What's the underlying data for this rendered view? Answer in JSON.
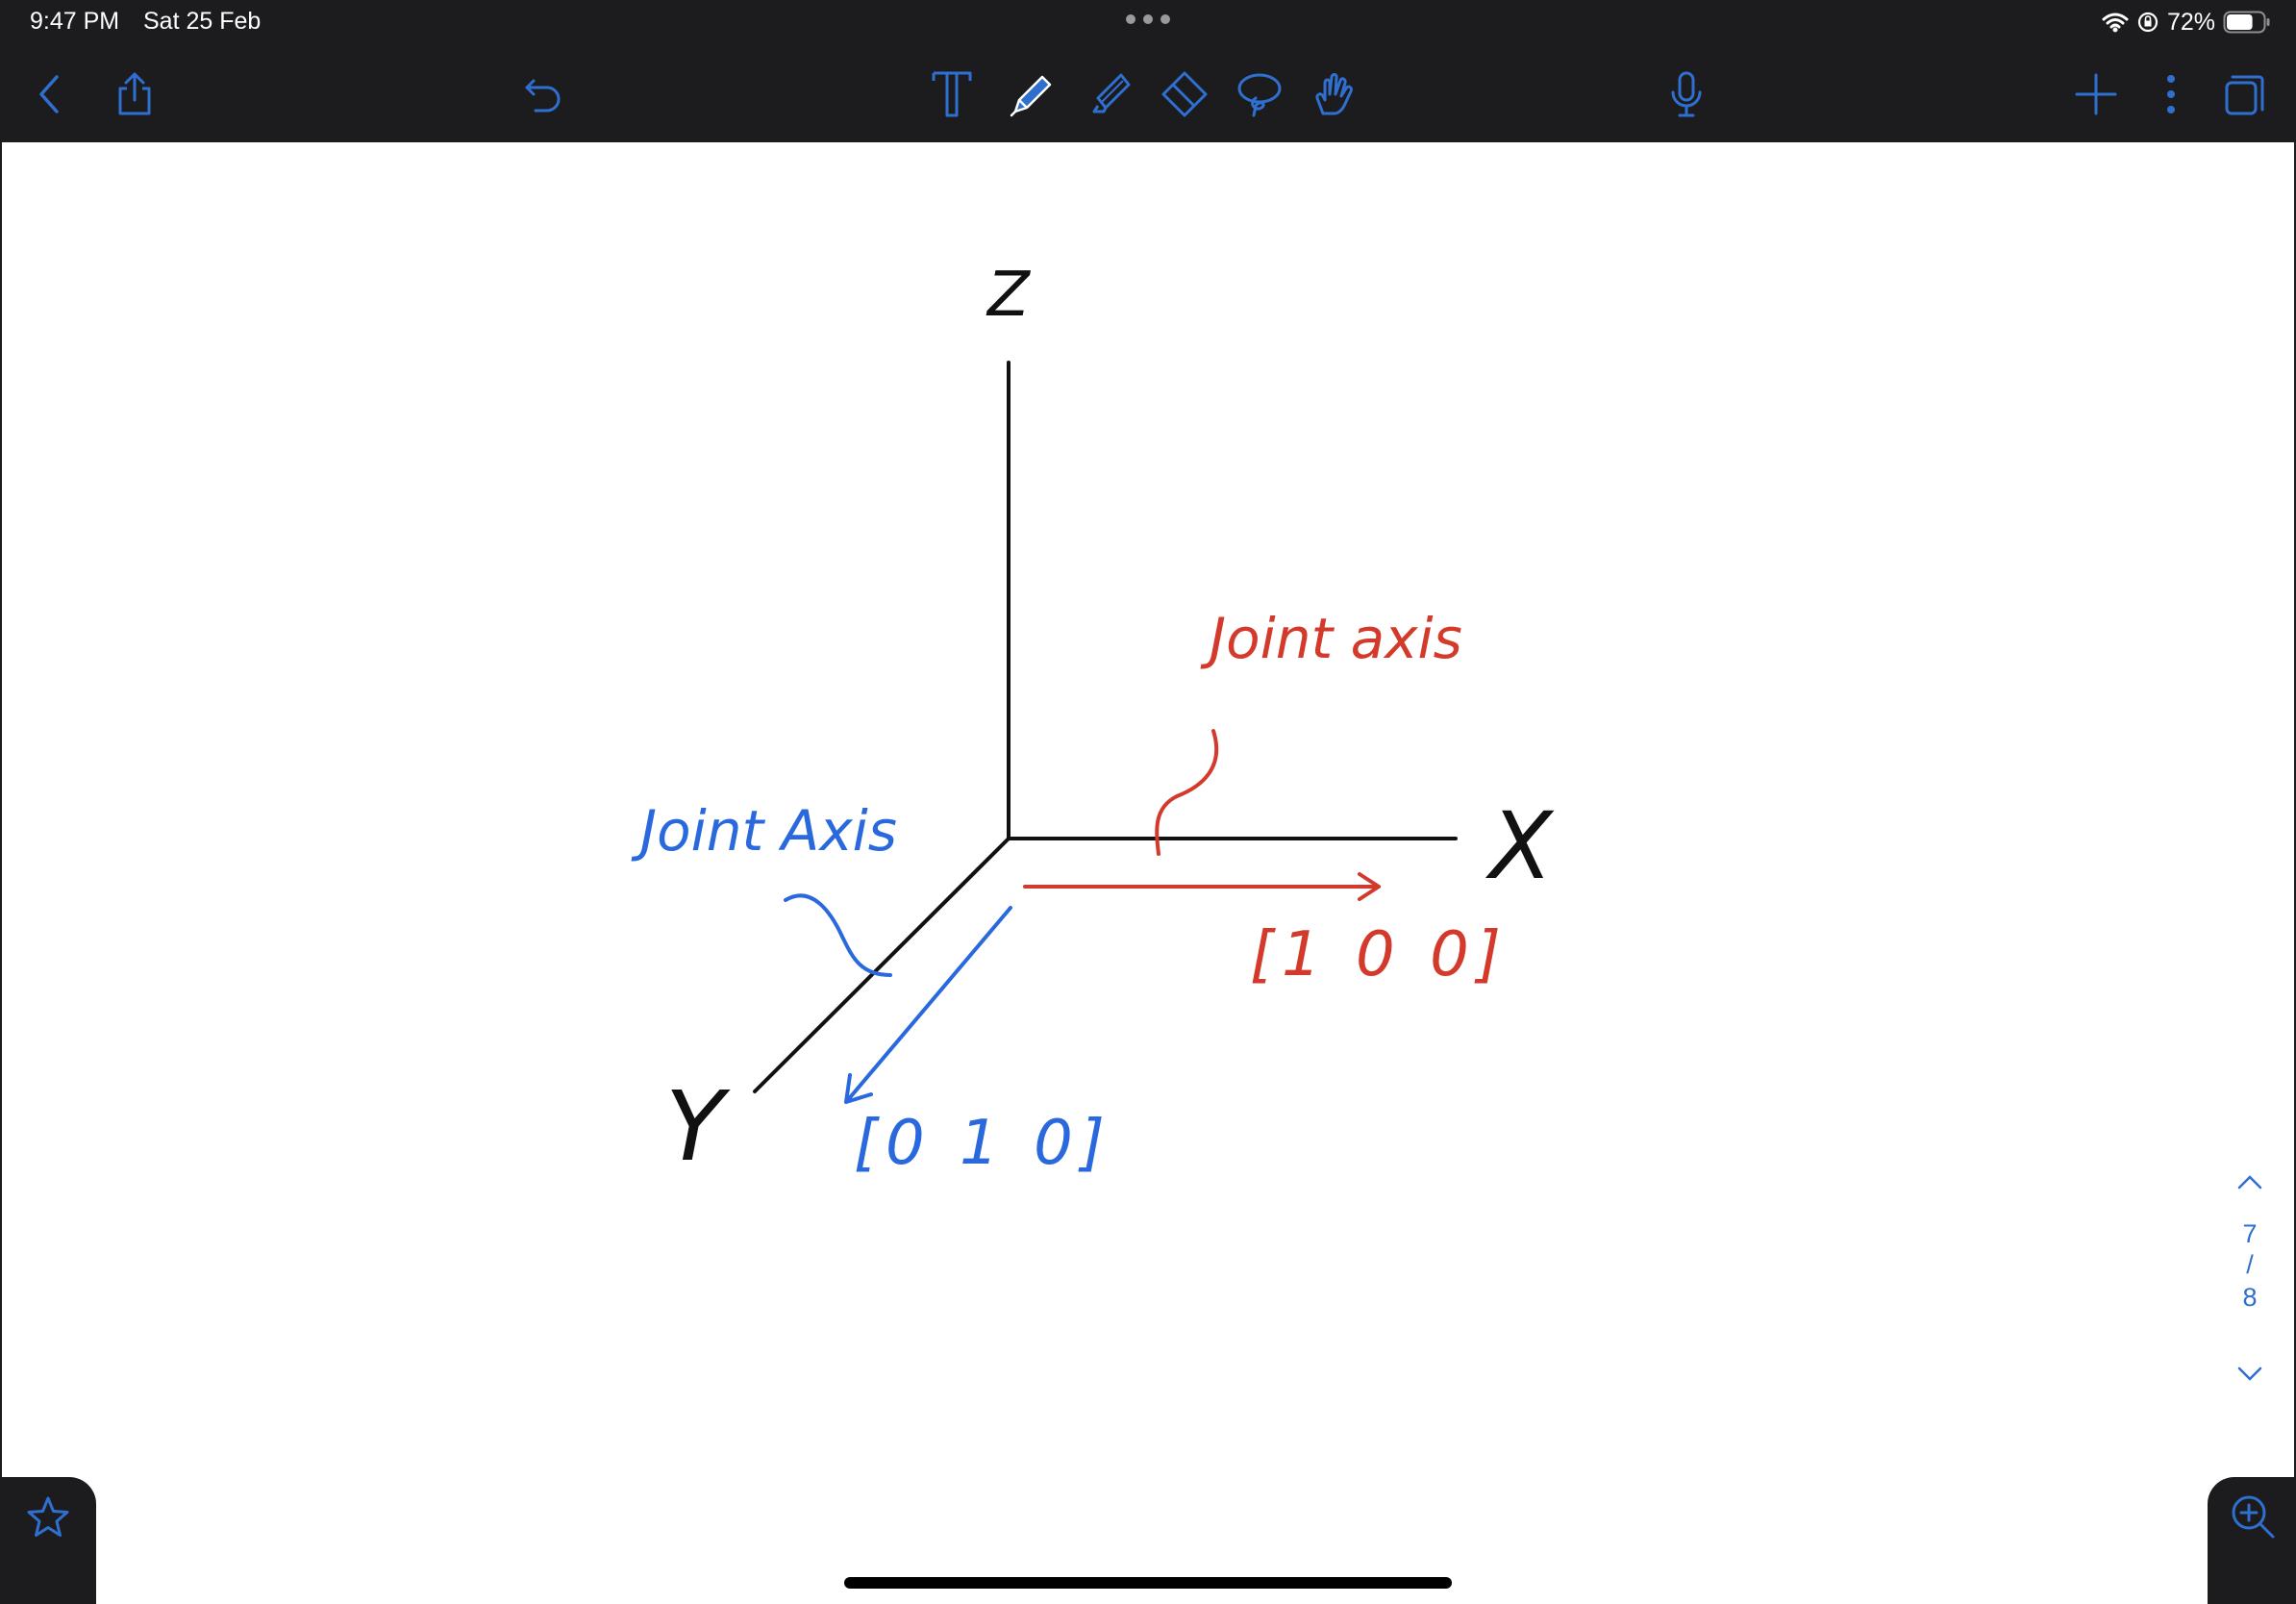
{
  "status": {
    "time": "9:47 PM",
    "date": "Sat 25 Feb",
    "battery": "72%",
    "battery_level": 0.72
  },
  "toolbar": {
    "left_icons": [
      "back-chevron-icon",
      "share-icon",
      "undo-icon"
    ],
    "tool_icons": [
      "text-tool-icon",
      "pen-tool-icon",
      "highlighter-tool-icon",
      "eraser-tool-icon",
      "lasso-tool-icon",
      "hand-tool-icon"
    ],
    "right_icons": [
      "microphone-icon",
      "add-page-icon",
      "more-options-icon",
      "pages-overview-icon"
    ],
    "active_tool": "pen-tool-icon",
    "accent_color": "#2f6fd0"
  },
  "canvas": {
    "axis_z": "Z",
    "axis_x": "X",
    "axis_y": "Y",
    "red_label": "Joint axis",
    "red_vector": "[1 0 0]",
    "blue_label": "Joint Axis",
    "blue_vector": "[0 1 0]",
    "ink_black": "#111111",
    "ink_red": "#d33a2c",
    "ink_blue": "#2a68de"
  },
  "page_nav": {
    "current": "7",
    "separator": "/",
    "total": "8"
  }
}
